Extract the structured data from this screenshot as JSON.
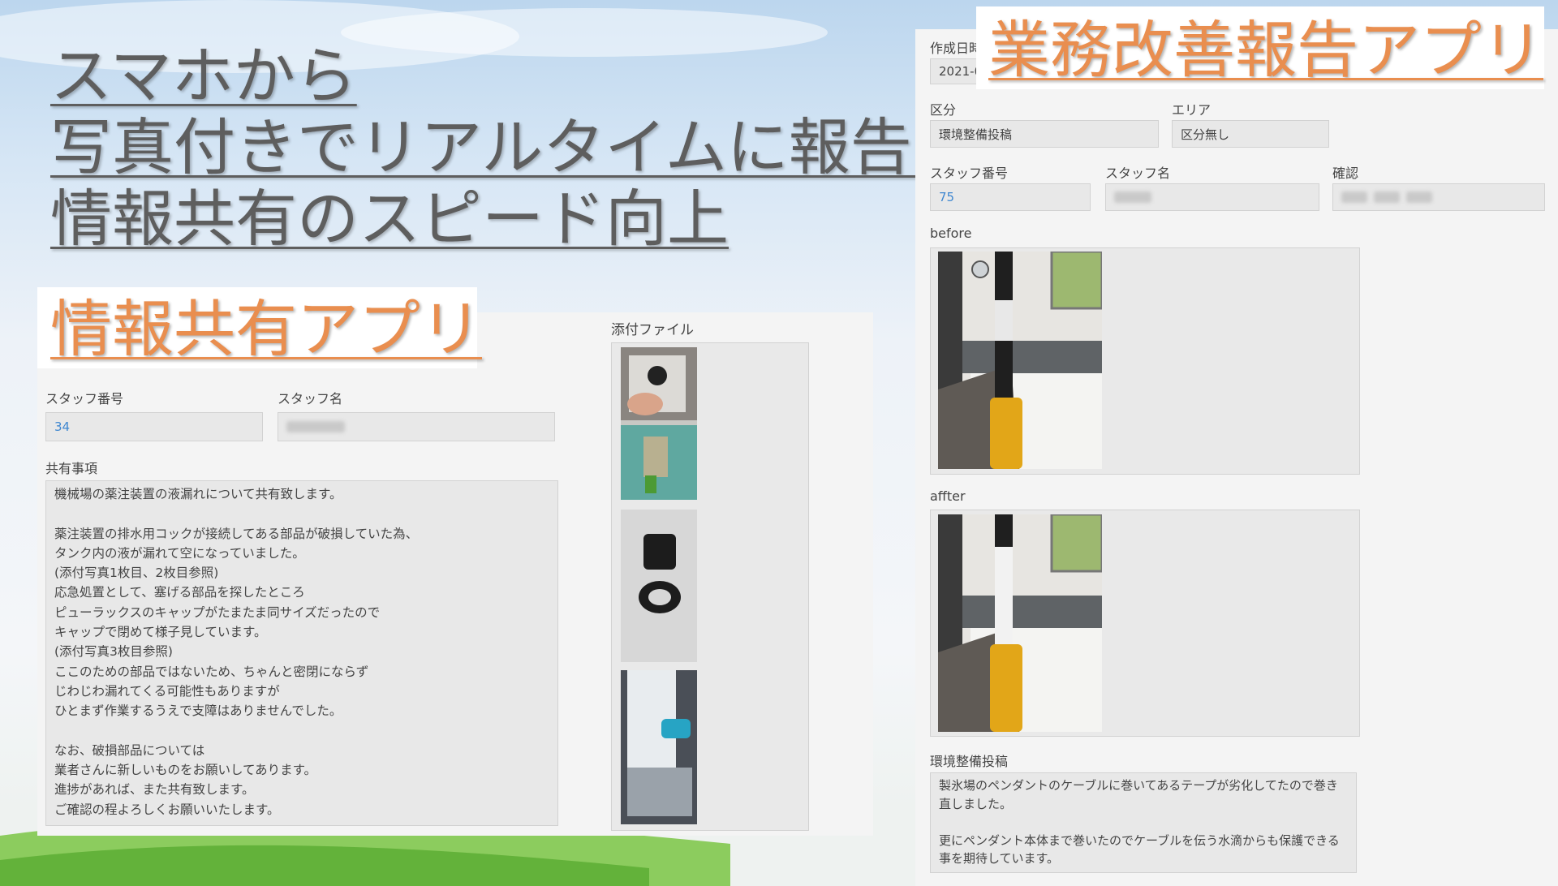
{
  "headline": {
    "line1": "スマホから",
    "line2": "写真付きでリアルタイムに報告！",
    "line3": "情報共有のスピード向上"
  },
  "info_share_app": {
    "title": "情報共有アプリ",
    "staff_number_label": "スタッフ番号",
    "staff_number_value": "34",
    "staff_name_label": "スタッフ名",
    "shared_items_label": "共有事項",
    "shared_items_text": "機械場の薬注装置の液漏れについて共有致します。\n\n薬注装置の排水用コックが接続してある部品が破損していた為、\nタンク内の液が漏れて空になっていました。\n(添付写真1枚目、2枚目参照)\n応急処置として、塞げる部品を探したところ\nピューラックスのキャップがたまたま同サイズだったので\nキャップで閉めて様子見しています。\n(添付写真3枚目参照)\nここのための部品ではないため、ちゃんと密閉にならず\nじわじわ漏れてくる可能性もありますが\nひとまず作業するうえで支障はありませんでした。\n\nなお、破損部品については\n業者さんに新しいものをお願いしてあります。\n進捗があれば、また共有致します。\nご確認の程よろしくお願いいたします。",
    "attachments_label": "添付ファイル"
  },
  "improvement_app": {
    "title": "業務改善報告アプリ",
    "created_label": "作成日時",
    "created_value": "2021-0",
    "category_label": "区分",
    "category_value": "環境整備投稿",
    "area_label": "エリア",
    "area_value": "区分無し",
    "staff_number_label": "スタッフ番号",
    "staff_number_value": "75",
    "staff_name_label": "スタッフ名",
    "confirm_label": "確認",
    "before_label": "before",
    "after_label": "affter",
    "post_label": "環境整備投稿",
    "post_text": "製氷場のペンダントのケーブルに巻いてあるテープが劣化してたので巻き\n直しました。\n\n更にペンダント本体まで巻いたのでケーブルを伝う水滴からも保護できる\n事を期待しています。"
  },
  "colors": {
    "headline": "#5e5e5e",
    "app_title": "#e98e4f",
    "link_value": "#3f87d0",
    "grass": "#63b23a"
  }
}
